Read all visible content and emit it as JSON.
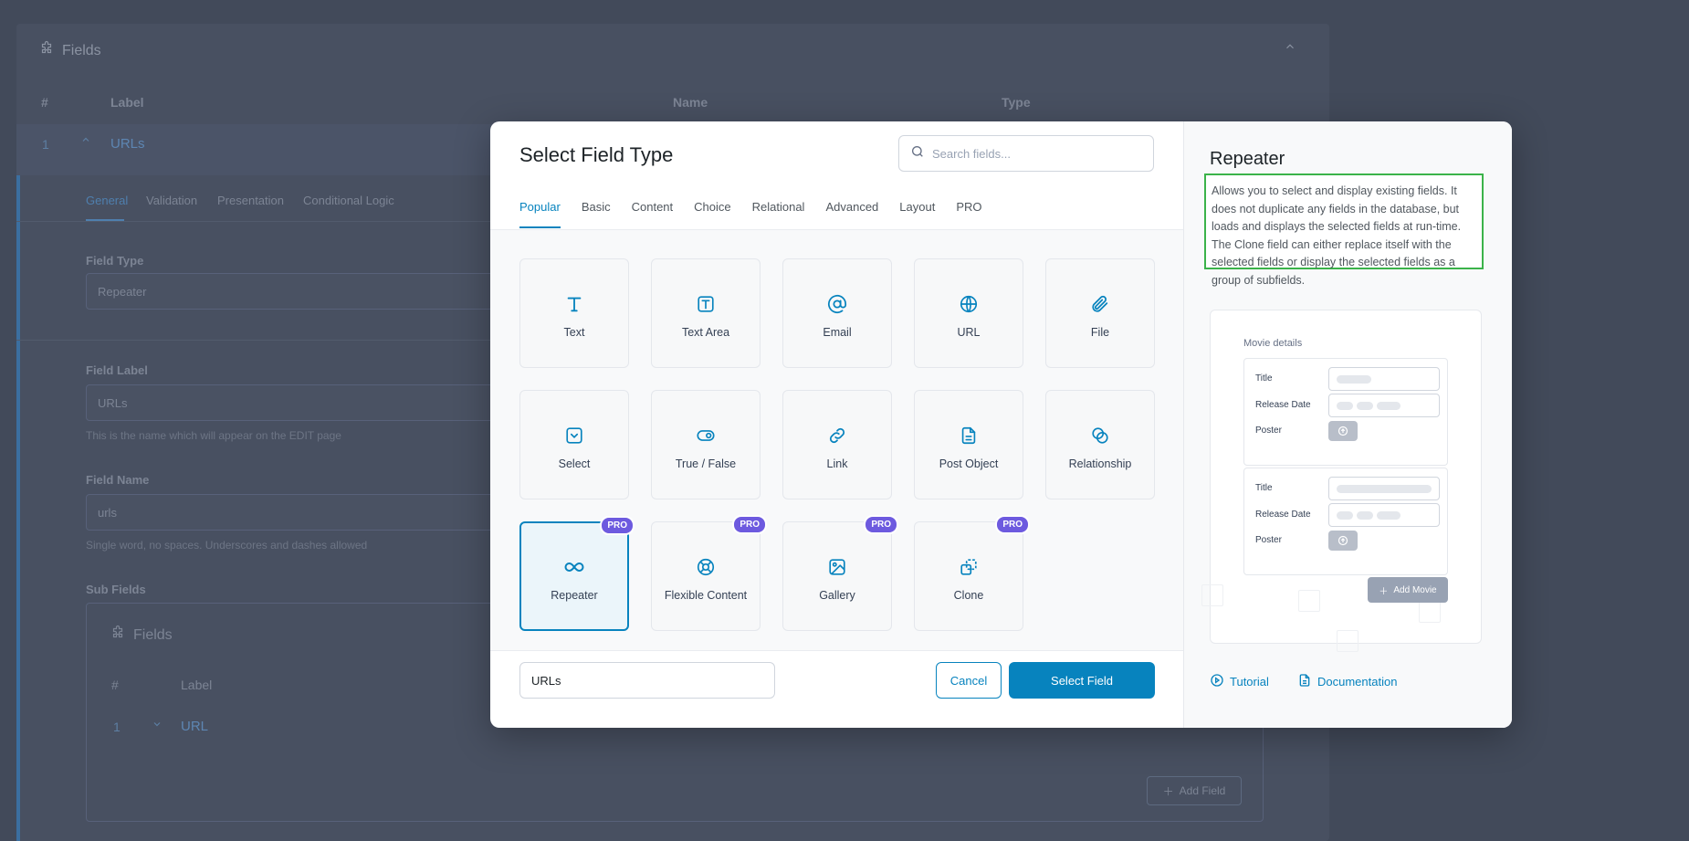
{
  "background": {
    "panel_title": "Fields",
    "columns": {
      "num": "#",
      "label": "Label",
      "name": "Name",
      "type": "Type"
    },
    "row": {
      "num": "1",
      "label": "URLs"
    },
    "tabs": [
      "General",
      "Validation",
      "Presentation",
      "Conditional Logic"
    ],
    "field_type": {
      "label": "Field Type",
      "value": "Repeater"
    },
    "field_label": {
      "label": "Field Label",
      "value": "URLs",
      "help": "This is the name which will appear on the EDIT page"
    },
    "field_name": {
      "label": "Field Name",
      "value": "urls",
      "help": "Single word, no spaces. Underscores and dashes allowed"
    },
    "sub_fields": {
      "label": "Sub Fields",
      "title": "Fields",
      "columns": {
        "num": "#",
        "label": "Label"
      },
      "row": {
        "num": "1",
        "label": "URL"
      },
      "add_button": "Add Field"
    }
  },
  "modal": {
    "title": "Select Field Type",
    "search_placeholder": "Search fields...",
    "tabs": [
      "Popular",
      "Basic",
      "Content",
      "Choice",
      "Relational",
      "Advanced",
      "Layout",
      "PRO"
    ],
    "active_tab": "Popular",
    "field_types": [
      {
        "label": "Text",
        "icon": "text-icon",
        "pro": false
      },
      {
        "label": "Text Area",
        "icon": "textarea-icon",
        "pro": false
      },
      {
        "label": "Email",
        "icon": "at-icon",
        "pro": false
      },
      {
        "label": "URL",
        "icon": "globe-icon",
        "pro": false
      },
      {
        "label": "File",
        "icon": "paperclip-icon",
        "pro": false
      },
      {
        "label": "Select",
        "icon": "select-icon",
        "pro": false
      },
      {
        "label": "True / False",
        "icon": "toggle-icon",
        "pro": false
      },
      {
        "label": "Link",
        "icon": "link-icon",
        "pro": false
      },
      {
        "label": "Post Object",
        "icon": "document-icon",
        "pro": false
      },
      {
        "label": "Relationship",
        "icon": "relationship-icon",
        "pro": false
      },
      {
        "label": "Repeater",
        "icon": "infinity-icon",
        "pro": true,
        "selected": true
      },
      {
        "label": "Flexible Content",
        "icon": "flexible-icon",
        "pro": true
      },
      {
        "label": "Gallery",
        "icon": "image-icon",
        "pro": true
      },
      {
        "label": "Clone",
        "icon": "clone-icon",
        "pro": true
      }
    ],
    "pro_badge": "PRO",
    "label_input_value": "URLs",
    "cancel_label": "Cancel",
    "select_label": "Select Field",
    "preview": {
      "title": "Repeater",
      "description": "Allows you to select and display existing fields. It does not duplicate any fields in the database, but loads and displays the selected fields at run-time. The Clone field can either replace itself with the selected fields or display the selected fields as a group of subfields.",
      "image": {
        "heading": "Movie details",
        "row_labels": [
          "Title",
          "Release Date",
          "Poster"
        ],
        "add_button": "Add Movie"
      },
      "tutorial_label": "Tutorial",
      "documentation_label": "Documentation"
    },
    "accent_color": "#0783be",
    "pro_color": "#6d5adf"
  }
}
